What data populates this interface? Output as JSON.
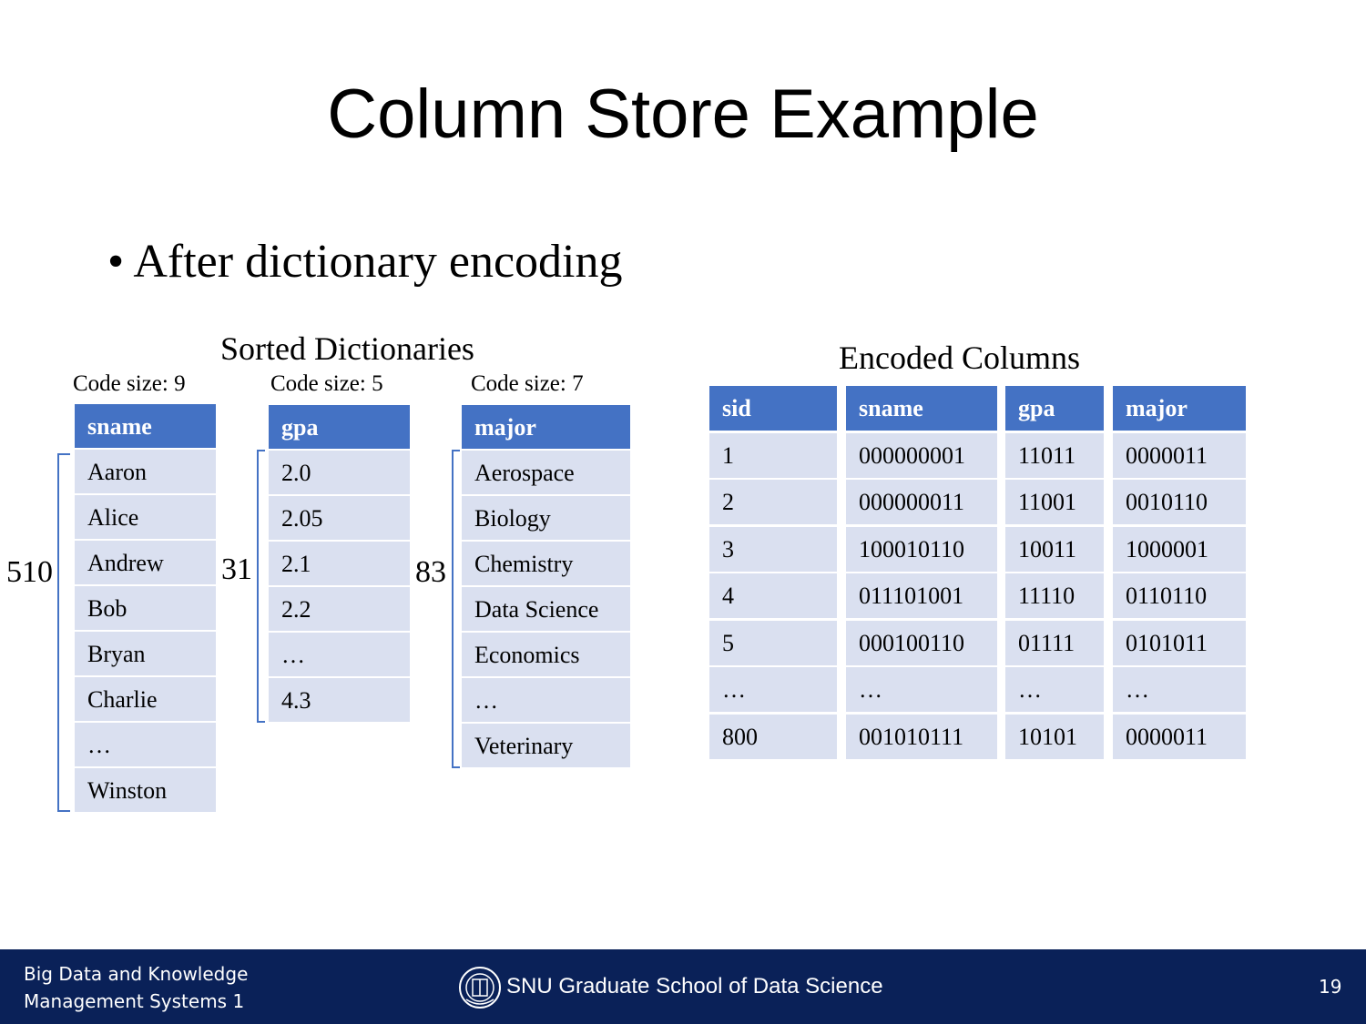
{
  "slide": {
    "title": "Column Store Example",
    "bullet": "After dictionary encoding",
    "bullet_marker": "•"
  },
  "dictionaries": {
    "heading": "Sorted Dictionaries",
    "sname": {
      "code_size": "Code size: 9",
      "count": "510",
      "header": "sname",
      "values": [
        "Aaron",
        "Alice",
        "Andrew",
        "Bob",
        "Bryan",
        "Charlie",
        "…",
        "Winston"
      ]
    },
    "gpa": {
      "code_size": "Code size: 5",
      "count": "31",
      "header": "gpa",
      "values": [
        "2.0",
        "2.05",
        "2.1",
        "2.2",
        "…",
        "4.3"
      ]
    },
    "major": {
      "code_size": "Code size: 7",
      "count": "83",
      "header": "major",
      "values": [
        "Aerospace",
        "Biology",
        "Chemistry",
        "Data Science",
        "Economics",
        "…",
        "Veterinary"
      ]
    }
  },
  "encoded": {
    "heading": "Encoded Columns",
    "headers": [
      "sid",
      "sname",
      "gpa",
      "major"
    ],
    "rows": [
      [
        "1",
        "000000001",
        "11011",
        "0000011"
      ],
      [
        "2",
        "000000011",
        "11001",
        "0010110"
      ],
      [
        "3",
        "100010110",
        "10011",
        "1000001"
      ],
      [
        "4",
        "011101001",
        "11110",
        "0110110"
      ],
      [
        "5",
        "000100110",
        "01111",
        "0101011"
      ],
      [
        "…",
        "…",
        "…",
        "…"
      ],
      [
        "800",
        "001010111",
        "10101",
        "0000011"
      ]
    ]
  },
  "footer": {
    "course_line1": "Big Data and Knowledge",
    "course_line2": "Management Systems 1",
    "school": "SNU Graduate School of Data Science",
    "page": "19"
  },
  "colors": {
    "header_fill": "#4472c4",
    "cell_fill": "#dae0f0",
    "footer_bg": "#0a2158",
    "bracket": "#4472c4"
  }
}
